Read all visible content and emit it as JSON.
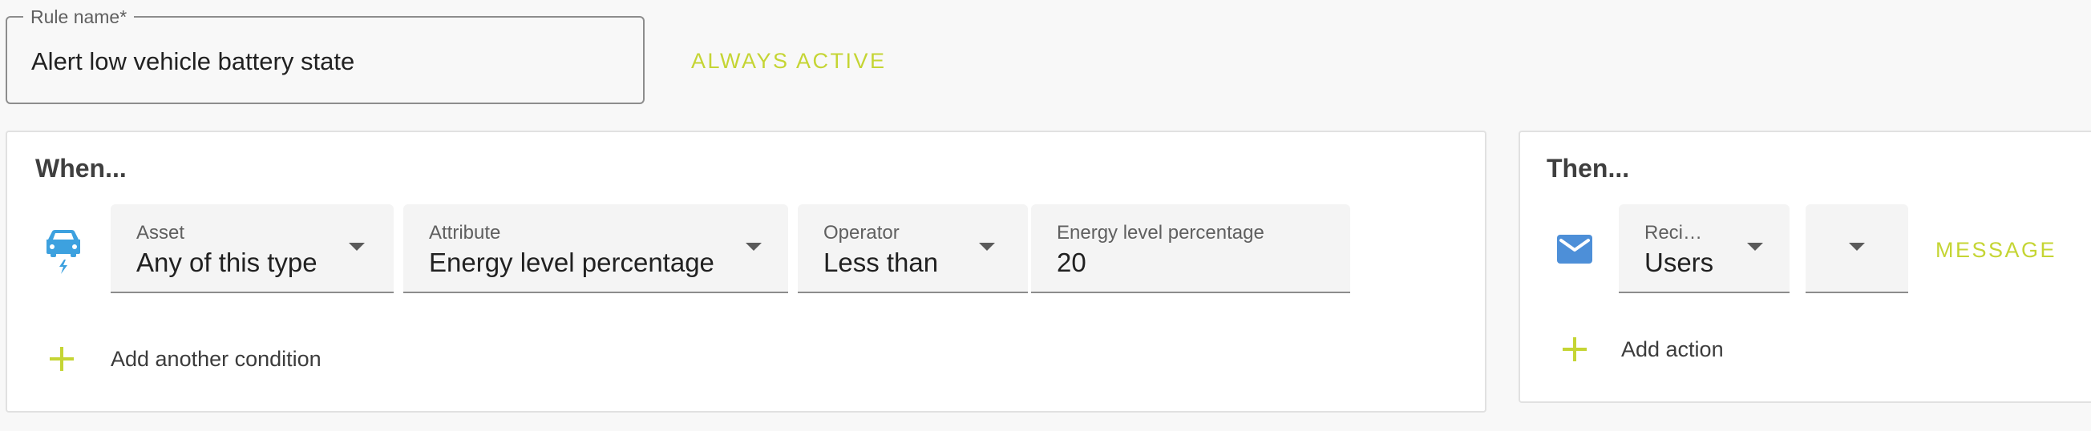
{
  "rule": {
    "name_label": "Rule name*",
    "name_value": "Alert low vehicle battery state",
    "schedule_button": "ALWAYS ACTIVE"
  },
  "when": {
    "heading": "When...",
    "asset_icon": "electric-vehicle-icon",
    "fields": {
      "asset": {
        "label": "Asset",
        "value": "Any of this type"
      },
      "attribute": {
        "label": "Attribute",
        "value": "Energy level percentage"
      },
      "operator": {
        "label": "Operator",
        "value": "Less than"
      },
      "threshold": {
        "label": "Energy level percentage",
        "value": "20"
      }
    },
    "add_condition": "Add another condition"
  },
  "then": {
    "heading": "Then...",
    "action_icon": "email-icon",
    "fields": {
      "recipients": {
        "label": "Reci…",
        "value": "Users"
      },
      "target": {
        "label": "",
        "value": ""
      }
    },
    "message_button": "MESSAGE",
    "add_action": "Add action"
  },
  "colors": {
    "accent": "#c5d534",
    "icon_blue": "#4d8fd8",
    "background": "#f8f8f8",
    "panel": "#ffffff"
  }
}
